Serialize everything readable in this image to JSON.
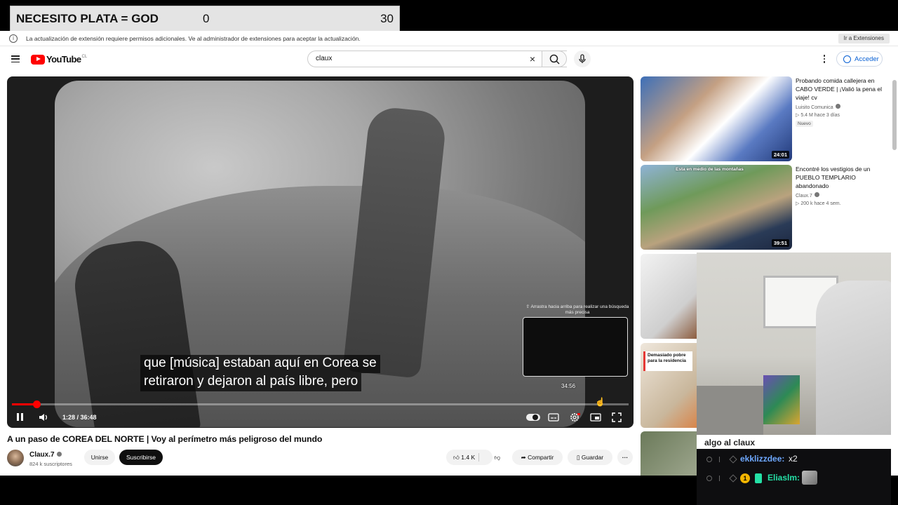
{
  "overlay": {
    "label": "NECESITO PLATA = GOD",
    "count_left": "0",
    "count_right": "30"
  },
  "infobar": {
    "message": "La actualización de extensión requiere permisos adicionales. Ve al administrador de extensiones para aceptar la actualización.",
    "button": "Ir a Extensiones"
  },
  "masthead": {
    "logo_text": "YouTube",
    "region": "CL",
    "search_value": "claux",
    "signin": "Acceder"
  },
  "player": {
    "preview_hint": "⇧ Arrastra hacia arriba para realizar una búsqueda más precisa",
    "preview_time": "34:56",
    "caption_line1": "que [música] estaban aquí en Corea se",
    "caption_line2": "retiraron y dejaron al país libre, pero",
    "time": "1:28 / 36:48",
    "progress_fraction": 0.04
  },
  "video": {
    "title": "A un paso de COREA DEL NORTE | Voy al perímetro más peligroso del mundo",
    "channel": "Claux.7",
    "subscribers": "824 k suscriptores",
    "join": "Unirse",
    "subscribe": "Suscribirse",
    "likes": "1.4 K",
    "share": "Compartir",
    "save": "Guardar",
    "more": "···"
  },
  "recommendations": [
    {
      "title": "Probando comida callejera en CABO VERDE | ¡Valió la pena el viaje! cv",
      "channel": "Luisito Comunica",
      "meta": "▷ 5.4 M   hace 3 días",
      "badge": "Nuevo",
      "duration": "24:01"
    },
    {
      "title": "Encontré los vestigios de un PUEBLO TEMPLARIO abandonado",
      "channel": "Claux.7",
      "meta": "▷ 200 k   hace 4 sem.",
      "overlay": "Esta en medio de las montañas",
      "duration": "39:51"
    },
    {
      "title": "",
      "channel": "",
      "meta": ""
    },
    {
      "title": "",
      "overlay": "Demasiado pobre para la residencia"
    },
    {
      "title": ""
    }
  ],
  "chat": {
    "partial_line": "algo al claux",
    "messages": [
      {
        "user": "ekklizzdee:",
        "text": "x2",
        "color": "#6ea8ff"
      },
      {
        "user": "Eliaslm:",
        "text": "",
        "color": "#24e0a6",
        "badge": "1"
      }
    ]
  },
  "colors": {
    "youtube_red": "#ff0000",
    "link_blue": "#065fd4"
  }
}
